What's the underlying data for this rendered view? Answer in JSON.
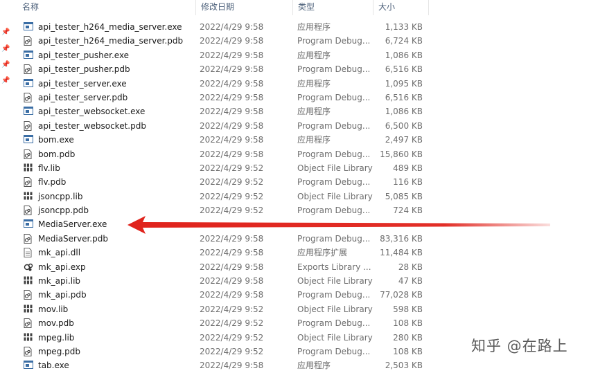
{
  "columns": {
    "name": "名称",
    "date": "修改日期",
    "type": "类型",
    "size": "大小"
  },
  "files": [
    {
      "name": "api_tester_h264_media_server.exe",
      "date": "2022/4/29 9:58",
      "type": "应用程序",
      "size": "1,133 KB",
      "icon": "exe-file-icon"
    },
    {
      "name": "api_tester_h264_media_server.pdb",
      "date": "2022/4/29 9:58",
      "type": "Program Debug...",
      "size": "6,724 KB",
      "icon": "pdb-file-icon"
    },
    {
      "name": "api_tester_pusher.exe",
      "date": "2022/4/29 9:58",
      "type": "应用程序",
      "size": "1,086 KB",
      "icon": "exe-file-icon"
    },
    {
      "name": "api_tester_pusher.pdb",
      "date": "2022/4/29 9:58",
      "type": "Program Debug...",
      "size": "6,516 KB",
      "icon": "pdb-file-icon"
    },
    {
      "name": "api_tester_server.exe",
      "date": "2022/4/29 9:58",
      "type": "应用程序",
      "size": "1,095 KB",
      "icon": "exe-file-icon"
    },
    {
      "name": "api_tester_server.pdb",
      "date": "2022/4/29 9:58",
      "type": "Program Debug...",
      "size": "6,516 KB",
      "icon": "pdb-file-icon"
    },
    {
      "name": "api_tester_websocket.exe",
      "date": "2022/4/29 9:58",
      "type": "应用程序",
      "size": "1,086 KB",
      "icon": "exe-file-icon"
    },
    {
      "name": "api_tester_websocket.pdb",
      "date": "2022/4/29 9:58",
      "type": "Program Debug...",
      "size": "6,500 KB",
      "icon": "pdb-file-icon"
    },
    {
      "name": "bom.exe",
      "date": "2022/4/29 9:58",
      "type": "应用程序",
      "size": "2,497 KB",
      "icon": "exe-file-icon"
    },
    {
      "name": "bom.pdb",
      "date": "2022/4/29 9:58",
      "type": "Program Debug...",
      "size": "15,860 KB",
      "icon": "pdb-file-icon"
    },
    {
      "name": "flv.lib",
      "date": "2022/4/29 9:52",
      "type": "Object File Library",
      "size": "489 KB",
      "icon": "lib-file-icon"
    },
    {
      "name": "flv.pdb",
      "date": "2022/4/29 9:52",
      "type": "Program Debug...",
      "size": "116 KB",
      "icon": "pdb-file-icon"
    },
    {
      "name": "jsoncpp.lib",
      "date": "2022/4/29 9:52",
      "type": "Object File Library",
      "size": "5,085 KB",
      "icon": "lib-file-icon"
    },
    {
      "name": "jsoncpp.pdb",
      "date": "2022/4/29 9:52",
      "type": "Program Debug...",
      "size": "724 KB",
      "icon": "pdb-file-icon"
    },
    {
      "name": "MediaServer.exe",
      "date": "",
      "type": "",
      "size": "",
      "icon": "exe-file-icon"
    },
    {
      "name": "MediaServer.pdb",
      "date": "2022/4/29 9:58",
      "type": "Program Debug...",
      "size": "83,316 KB",
      "icon": "pdb-file-icon"
    },
    {
      "name": "mk_api.dll",
      "date": "2022/4/29 9:58",
      "type": "应用程序扩展",
      "size": "11,484 KB",
      "icon": "dll-file-icon"
    },
    {
      "name": "mk_api.exp",
      "date": "2022/4/29 9:58",
      "type": "Exports Library ...",
      "size": "28 KB",
      "icon": "exp-file-icon"
    },
    {
      "name": "mk_api.lib",
      "date": "2022/4/29 9:58",
      "type": "Object File Library",
      "size": "47 KB",
      "icon": "lib-file-icon"
    },
    {
      "name": "mk_api.pdb",
      "date": "2022/4/29 9:58",
      "type": "Program Debug...",
      "size": "77,028 KB",
      "icon": "pdb-file-icon"
    },
    {
      "name": "mov.lib",
      "date": "2022/4/29 9:52",
      "type": "Object File Library",
      "size": "598 KB",
      "icon": "lib-file-icon"
    },
    {
      "name": "mov.pdb",
      "date": "2022/4/29 9:52",
      "type": "Program Debug...",
      "size": "108 KB",
      "icon": "pdb-file-icon"
    },
    {
      "name": "mpeg.lib",
      "date": "2022/4/29 9:52",
      "type": "Object File Library",
      "size": "280 KB",
      "icon": "lib-file-icon"
    },
    {
      "name": "mpeg.pdb",
      "date": "2022/4/29 9:52",
      "type": "Program Debug...",
      "size": "108 KB",
      "icon": "pdb-file-icon"
    },
    {
      "name": "tab.exe",
      "date": "2022/4/29 9:58",
      "type": "应用程序",
      "size": "2,503 KB",
      "icon": "exe-file-icon"
    }
  ],
  "annotation": {
    "arrow_color": "#e0231c",
    "target": "MediaServer.exe"
  },
  "watermark": "知乎 @在路上",
  "colors": {
    "header_text": "#4c607a",
    "secondary_text": "#6d6d6d",
    "pin": "#7a8a9a"
  }
}
